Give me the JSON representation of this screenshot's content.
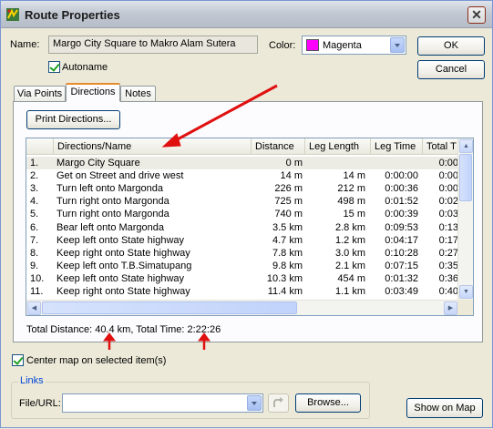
{
  "window": {
    "title": "Route Properties",
    "close_glyph": "✕"
  },
  "name": {
    "label": "Name:",
    "value": "Margo City Square to Makro Alam Sutera"
  },
  "autoname": {
    "label": "Autoname",
    "checked": true
  },
  "color": {
    "label": "Color:",
    "value": "Magenta",
    "swatch": "#ff00ff"
  },
  "buttons": {
    "ok": "OK",
    "cancel": "Cancel",
    "print": "Print Directions...",
    "browse": "Browse...",
    "show_on_map": "Show on Map"
  },
  "tabs": [
    {
      "label": "Via Points",
      "active": false
    },
    {
      "label": "Directions",
      "active": true
    },
    {
      "label": "Notes",
      "active": false
    }
  ],
  "table": {
    "columns": [
      "Directions/Name",
      "Distance",
      "Leg Length",
      "Leg Time",
      "Total T"
    ],
    "rows": [
      {
        "num": "1.",
        "name": "Margo City Square",
        "distance": "0 m",
        "leg_length": "",
        "leg_time": "",
        "total": "0:00"
      },
      {
        "num": "2.",
        "name": "Get on Street and drive west",
        "distance": "14 m",
        "leg_length": "14 m",
        "leg_time": "0:00:00",
        "total": "0:00"
      },
      {
        "num": "3.",
        "name": "Turn left onto Margonda",
        "distance": "226 m",
        "leg_length": "212 m",
        "leg_time": "0:00:36",
        "total": "0:00"
      },
      {
        "num": "4.",
        "name": "Turn right onto Margonda",
        "distance": "725 m",
        "leg_length": "498 m",
        "leg_time": "0:01:52",
        "total": "0:02"
      },
      {
        "num": "5.",
        "name": "Turn right onto Margonda",
        "distance": "740 m",
        "leg_length": "15 m",
        "leg_time": "0:00:39",
        "total": "0:03"
      },
      {
        "num": "6.",
        "name": "Bear left onto Margonda",
        "distance": "3.5 km",
        "leg_length": "2.8 km",
        "leg_time": "0:09:53",
        "total": "0:13"
      },
      {
        "num": "7.",
        "name": "Keep left onto State highway",
        "distance": "4.7 km",
        "leg_length": "1.2 km",
        "leg_time": "0:04:17",
        "total": "0:17"
      },
      {
        "num": "8.",
        "name": "Keep right onto State highway",
        "distance": "7.8 km",
        "leg_length": "3.0 km",
        "leg_time": "0:10:28",
        "total": "0:27"
      },
      {
        "num": "9.",
        "name": "Keep left onto T.B.Simatupang",
        "distance": "9.8 km",
        "leg_length": "2.1 km",
        "leg_time": "0:07:15",
        "total": "0:35"
      },
      {
        "num": "10.",
        "name": "Keep left onto State highway",
        "distance": "10.3 km",
        "leg_length": "454 m",
        "leg_time": "0:01:32",
        "total": "0:36"
      },
      {
        "num": "11.",
        "name": "Keep right onto State highway",
        "distance": "11.4 km",
        "leg_length": "1.1 km",
        "leg_time": "0:03:49",
        "total": "0:40"
      }
    ]
  },
  "summary": "Total Distance: 40.4 km, Total Time: 2:22:26",
  "center_map": {
    "label": "Center map on selected item(s)",
    "checked": true
  },
  "links": {
    "group_label": "Links",
    "file_label": "File/URL:",
    "value": ""
  },
  "annotation_color": "#e01010"
}
